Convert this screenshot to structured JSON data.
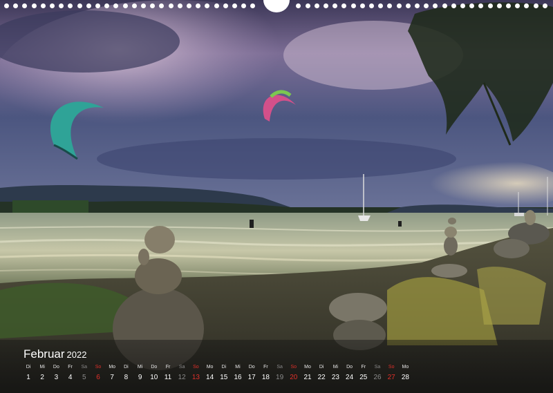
{
  "calendar": {
    "month": "Februar",
    "year": "2022",
    "days": [
      {
        "dow": "Di",
        "num": "1",
        "type": "weekday"
      },
      {
        "dow": "Mi",
        "num": "2",
        "type": "weekday"
      },
      {
        "dow": "Do",
        "num": "3",
        "type": "weekday"
      },
      {
        "dow": "Fr",
        "num": "4",
        "type": "weekday"
      },
      {
        "dow": "Sa",
        "num": "5",
        "type": "sat"
      },
      {
        "dow": "So",
        "num": "6",
        "type": "sun"
      },
      {
        "dow": "Mo",
        "num": "7",
        "type": "weekday"
      },
      {
        "dow": "Di",
        "num": "8",
        "type": "weekday"
      },
      {
        "dow": "Mi",
        "num": "9",
        "type": "weekday"
      },
      {
        "dow": "Do",
        "num": "10",
        "type": "weekday"
      },
      {
        "dow": "Fr",
        "num": "11",
        "type": "weekday"
      },
      {
        "dow": "Sa",
        "num": "12",
        "type": "sat"
      },
      {
        "dow": "So",
        "num": "13",
        "type": "sun"
      },
      {
        "dow": "Mo",
        "num": "14",
        "type": "weekday"
      },
      {
        "dow": "Di",
        "num": "15",
        "type": "weekday"
      },
      {
        "dow": "Mi",
        "num": "16",
        "type": "weekday"
      },
      {
        "dow": "Do",
        "num": "17",
        "type": "weekday"
      },
      {
        "dow": "Fr",
        "num": "18",
        "type": "weekday"
      },
      {
        "dow": "Sa",
        "num": "19",
        "type": "sat"
      },
      {
        "dow": "So",
        "num": "20",
        "type": "sun"
      },
      {
        "dow": "Mo",
        "num": "21",
        "type": "weekday"
      },
      {
        "dow": "Di",
        "num": "22",
        "type": "weekday"
      },
      {
        "dow": "Mi",
        "num": "23",
        "type": "weekday"
      },
      {
        "dow": "Do",
        "num": "24",
        "type": "weekday"
      },
      {
        "dow": "Fr",
        "num": "25",
        "type": "weekday"
      },
      {
        "dow": "Sa",
        "num": "26",
        "type": "sat"
      },
      {
        "dow": "So",
        "num": "27",
        "type": "sun"
      },
      {
        "dow": "Mo",
        "num": "28",
        "type": "weekday"
      }
    ]
  },
  "colors": {
    "sunday": "#e0302a",
    "saturday": "#8a8a8a",
    "weekday": "#ffffff"
  }
}
